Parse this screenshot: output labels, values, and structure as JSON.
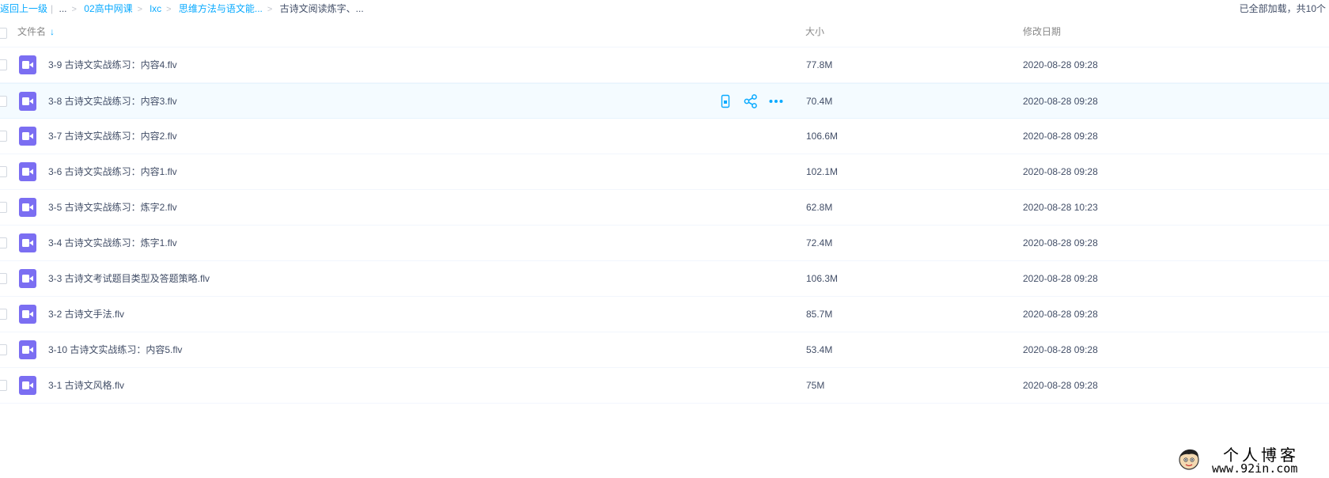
{
  "breadcrumb": {
    "back_label": "返回上一级",
    "ellipsis": "...",
    "items": [
      {
        "label": "02高中网课"
      },
      {
        "label": "lxc"
      },
      {
        "label": "思维方法与语文能..."
      }
    ],
    "current": "古诗文阅读炼字、..."
  },
  "status": {
    "loaded_text": "已全部加载，共10个"
  },
  "columns": {
    "name": "文件名",
    "size": "大小",
    "modified": "修改日期"
  },
  "icons": {
    "file_type": "video-file-icon",
    "sort": "sort-arrow-down-icon",
    "actions": [
      "mobile-icon",
      "share-icon",
      "more-icon"
    ]
  },
  "colors": {
    "accent": "#09aaff",
    "video_icon_bg": "#7b6ef2",
    "hover_row_bg": "#f4fbff"
  },
  "files": [
    {
      "name": "3-9 古诗文实战练习：内容4.flv",
      "size": "77.8M",
      "date": "2020-08-28 09:28"
    },
    {
      "name": "3-8 古诗文实战练习：内容3.flv",
      "size": "70.4M",
      "date": "2020-08-28 09:28"
    },
    {
      "name": "3-7 古诗文实战练习：内容2.flv",
      "size": "106.6M",
      "date": "2020-08-28 09:28"
    },
    {
      "name": "3-6 古诗文实战练习：内容1.flv",
      "size": "102.1M",
      "date": "2020-08-28 09:28"
    },
    {
      "name": "3-5 古诗文实战练习：炼字2.flv",
      "size": "62.8M",
      "date": "2020-08-28 10:23"
    },
    {
      "name": "3-4 古诗文实战练习：炼字1.flv",
      "size": "72.4M",
      "date": "2020-08-28 09:28"
    },
    {
      "name": "3-3 古诗文考试题目类型及答题策略.flv",
      "size": "106.3M",
      "date": "2020-08-28 09:28"
    },
    {
      "name": "3-2 古诗文手法.flv",
      "size": "85.7M",
      "date": "2020-08-28 09:28"
    },
    {
      "name": "3-10 古诗文实战练习：内容5.flv",
      "size": "53.4M",
      "date": "2020-08-28 09:28"
    },
    {
      "name": "3-1 古诗文风格.flv",
      "size": "75M",
      "date": "2020-08-28 09:28"
    }
  ],
  "watermark": {
    "title": "个人博客",
    "url": "www.92in.com"
  }
}
